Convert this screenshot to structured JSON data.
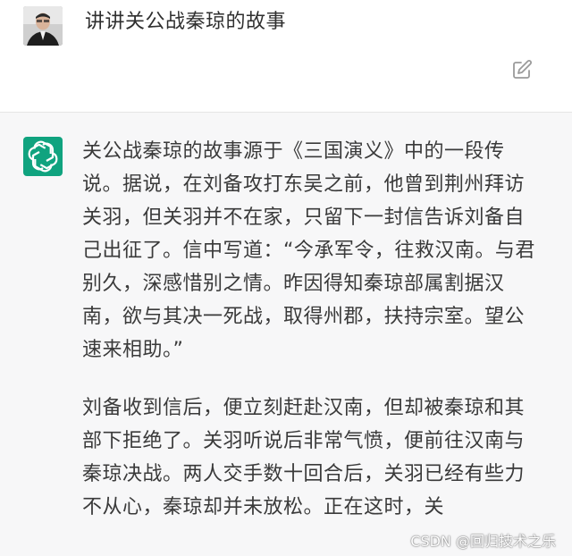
{
  "user": {
    "avatar_icon": "user-avatar-photo",
    "message": "讲讲关公战秦琼的故事",
    "edit_icon": "edit-icon"
  },
  "assistant": {
    "logo_icon": "openai-logo-icon",
    "logo_color": "#10a37f",
    "paragraphs": [
      "关公战秦琼的故事源于《三国演义》中的一段传说。据说，在刘备攻打东吴之前，他曾到荆州拜访关羽，但关羽并不在家，只留下一封信告诉刘备自己出征了。信中写道：“今承军令，往救汉南。与君别久，深感惜别之情。昨因得知秦琼部属割据汉南，欲与其决一死战，取得州郡，扶持宗室。望公速来相助。”",
      "刘备收到信后，便立刻赶赴汉南，但却被秦琼和其部下拒绝了。关羽听说后非常气愤，便前往汉南与秦琼决战。两人交手数十回合后，关羽已经有些力不从心，秦琼却并未放松。正在这时，关"
    ]
  },
  "watermark": "CSDN @回归技术之乐",
  "colors": {
    "assistant_bg": "#f7f7f8",
    "user_bg": "#ffffff",
    "text": "#3a3a3a"
  }
}
